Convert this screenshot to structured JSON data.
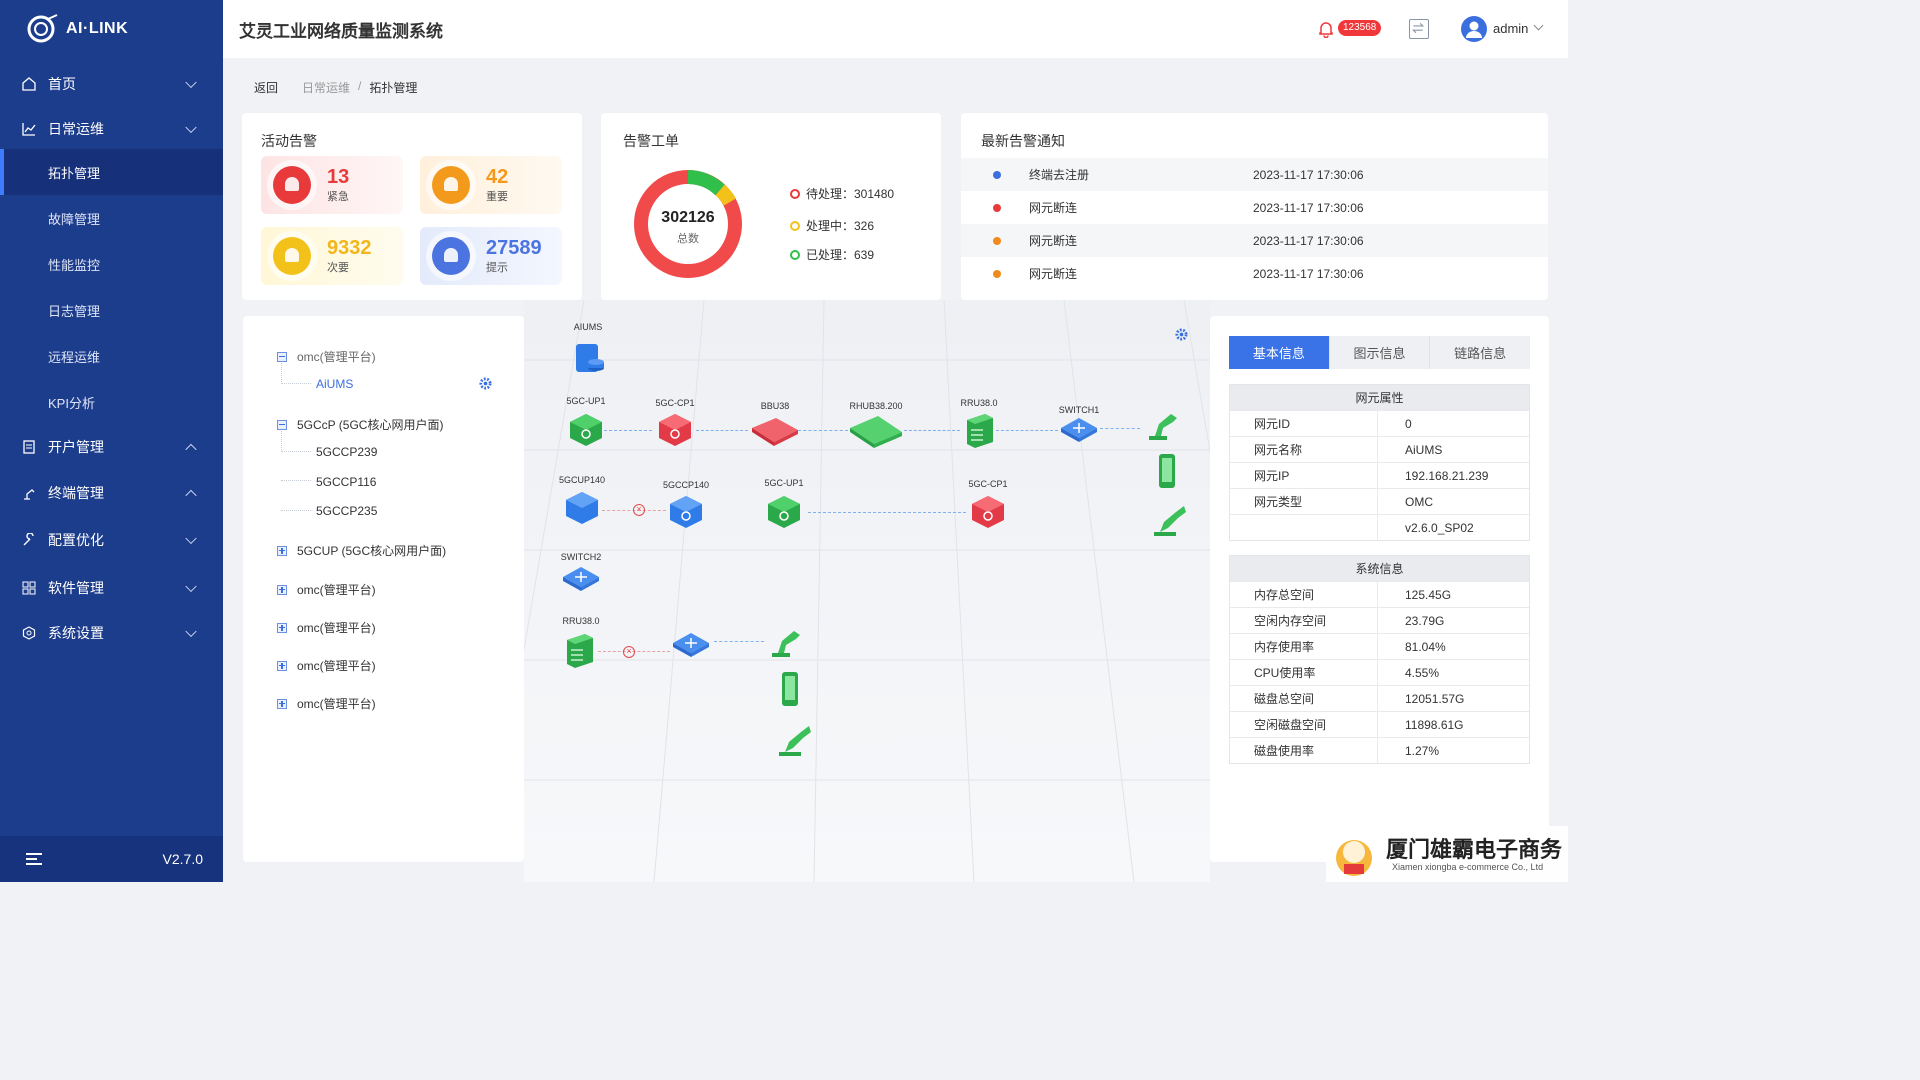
{
  "app": {
    "logo_text": "AI·LINK",
    "title": "艾灵工业网络质量监测系统",
    "version": "V2.7.0",
    "notification_count": "123568",
    "user": "admin"
  },
  "sidebar": {
    "items": [
      {
        "label": "首页",
        "icon": "home-icon",
        "expanded": false
      },
      {
        "label": "日常运维",
        "icon": "chart-line-icon",
        "expanded": true
      },
      {
        "label": "开户管理",
        "icon": "document-icon",
        "expanded": true
      },
      {
        "label": "终端管理",
        "icon": "robot-arm-icon",
        "expanded": true
      },
      {
        "label": "配置优化",
        "icon": "wrench-icon",
        "expanded": false
      },
      {
        "label": "软件管理",
        "icon": "grid-icon",
        "expanded": false
      },
      {
        "label": "系统设置",
        "icon": "settings-icon",
        "expanded": false
      }
    ],
    "sub_items": [
      "拓扑管理",
      "故障管理",
      "性能监控",
      "日志管理",
      "远程运维",
      "KPI分析"
    ],
    "active_sub": "拓扑管理"
  },
  "breadcrumb": {
    "back": "返回",
    "parent": "日常运维",
    "separator": "/",
    "current": "拓扑管理"
  },
  "active_alarms": {
    "title": "活动告警",
    "items": [
      {
        "count": "13",
        "label": "紧急",
        "color": "#e83a3a"
      },
      {
        "count": "42",
        "label": "重要",
        "color": "#f39a1c"
      },
      {
        "count": "9332",
        "label": "次要",
        "color": "#f2c21b"
      },
      {
        "count": "27589",
        "label": "提示",
        "color": "#4b74e0"
      }
    ]
  },
  "work_orders": {
    "title": "告警工单",
    "total": "302126",
    "total_label": "总数",
    "legend": [
      {
        "label": "待处理：301480",
        "value": 301480,
        "color": "#f04a4a"
      },
      {
        "label": "处理中：326",
        "value": 326,
        "color": "#f2c21b"
      },
      {
        "label": "已处理：639",
        "value": 639,
        "color": "#2fbf4a"
      }
    ]
  },
  "notices": {
    "title": "最新告警通知",
    "rows": [
      {
        "text": "终端去注册",
        "time": "2023-11-17 17:30:06",
        "color": "#3a6fe0"
      },
      {
        "text": "网元断连",
        "time": "2023-11-17 17:30:06",
        "color": "#e83a3a"
      },
      {
        "text": "网元断连",
        "time": "2023-11-17 17:30:06",
        "color": "#f08a1c"
      },
      {
        "text": "网元断连",
        "time": "2023-11-17 17:30:06",
        "color": "#f08a1c"
      }
    ]
  },
  "tree": {
    "nodes": [
      {
        "label": "omc(管理平台)",
        "type": "minus"
      },
      {
        "label": "AiUMS",
        "type": "leaf-selected"
      },
      {
        "label": "5GCcP (5GC核心网用户面)",
        "type": "minus"
      },
      {
        "label": "5GCCP239",
        "type": "leaf"
      },
      {
        "label": "5GCCP116",
        "type": "leaf"
      },
      {
        "label": "5GCCP235",
        "type": "leaf"
      },
      {
        "label": "5GCUP (5GC核心网用户面)",
        "type": "plus"
      },
      {
        "label": "omc(管理平台)",
        "type": "plus"
      },
      {
        "label": "omc(管理平台)",
        "type": "plus"
      },
      {
        "label": "omc(管理平台)",
        "type": "plus"
      },
      {
        "label": "omc(管理平台)",
        "type": "plus"
      }
    ]
  },
  "topology": {
    "labels": [
      "AIUMS",
      "5GC-UP1",
      "5GC-CP1",
      "BBU38",
      "RHUB38.200",
      "RRU38.0",
      "SWITCH1",
      "5GCUP140",
      "5GCCP140",
      "5GC-UP1",
      "5GC-CP1",
      "SWITCH2",
      "RRU38.0"
    ]
  },
  "info_panel": {
    "tabs": [
      "基本信息",
      "图示信息",
      "链路信息"
    ],
    "active_tab": "基本信息",
    "ne_title": "网元属性",
    "ne_rows": [
      {
        "k": "网元ID",
        "v": "0"
      },
      {
        "k": "网元名称",
        "v": "AiUMS"
      },
      {
        "k": "网元IP",
        "v": "192.168.21.239"
      },
      {
        "k": "网元类型",
        "v": "OMC"
      },
      {
        "k": "",
        "v": "v2.6.0_SP02"
      }
    ],
    "sys_title": "系统信息",
    "sys_rows": [
      {
        "k": "内存总空间",
        "v": "125.45G"
      },
      {
        "k": "空闲内存空间",
        "v": "23.79G"
      },
      {
        "k": "内存使用率",
        "v": "81.04%"
      },
      {
        "k": "CPU使用率",
        "v": "4.55%"
      },
      {
        "k": "磁盘总空间",
        "v": "12051.57G"
      },
      {
        "k": "空闲磁盘空间",
        "v": "11898.61G"
      },
      {
        "k": "磁盘使用率",
        "v": "1.27%"
      }
    ]
  },
  "watermark": {
    "cn": "厦门雄霸电子商务",
    "en": "Xiamen xiongba e-commerce Co., Ltd"
  }
}
